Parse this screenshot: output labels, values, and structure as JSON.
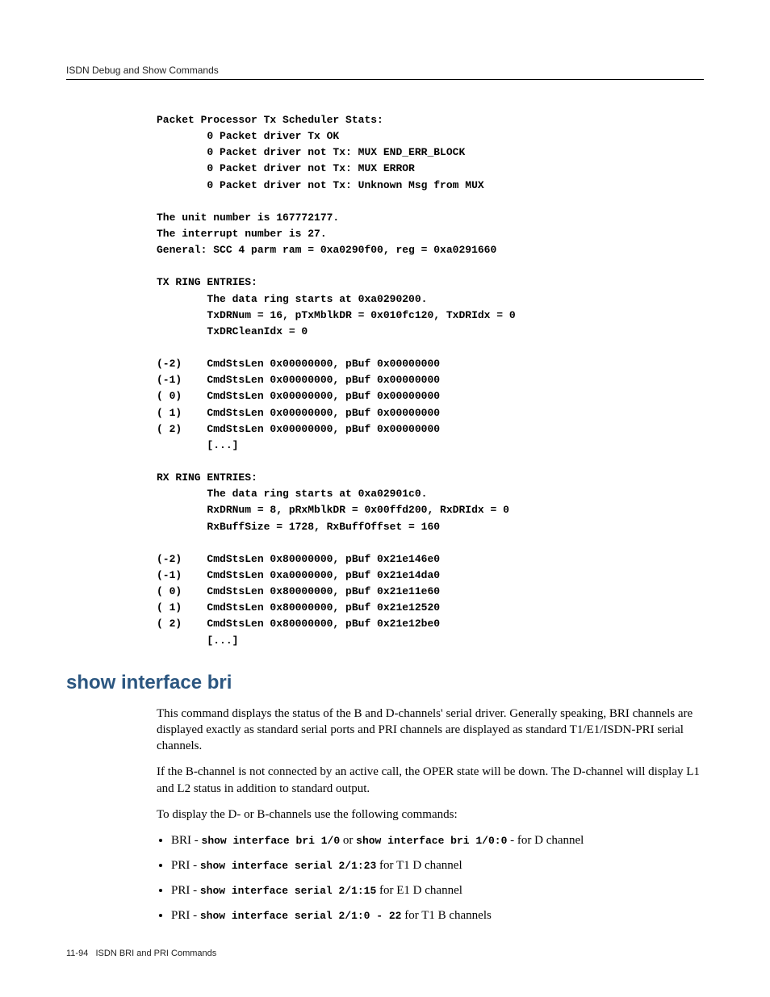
{
  "header": {
    "running_head": "ISDN Debug and Show Commands"
  },
  "code": {
    "block": "Packet Processor Tx Scheduler Stats:\n        0 Packet driver Tx OK\n        0 Packet driver not Tx: MUX END_ERR_BLOCK\n        0 Packet driver not Tx: MUX ERROR\n        0 Packet driver not Tx: Unknown Msg from MUX\n\nThe unit number is 167772177.\nThe interrupt number is 27.\nGeneral: SCC 4 parm ram = 0xa0290f00, reg = 0xa0291660\n\nTX RING ENTRIES:\n        The data ring starts at 0xa0290200.\n        TxDRNum = 16, pTxMblkDR = 0x010fc120, TxDRIdx = 0\n        TxDRCleanIdx = 0\n\n(-2)    CmdStsLen 0x00000000, pBuf 0x00000000\n(-1)    CmdStsLen 0x00000000, pBuf 0x00000000\n( 0)    CmdStsLen 0x00000000, pBuf 0x00000000\n( 1)    CmdStsLen 0x00000000, pBuf 0x00000000\n( 2)    CmdStsLen 0x00000000, pBuf 0x00000000\n        [...]\n\nRX RING ENTRIES:\n        The data ring starts at 0xa02901c0.\n        RxDRNum = 8, pRxMblkDR = 0x00ffd200, RxDRIdx = 0\n        RxBuffSize = 1728, RxBuffOffset = 160\n\n(-2)    CmdStsLen 0x80000000, pBuf 0x21e146e0\n(-1)    CmdStsLen 0xa0000000, pBuf 0x21e14da0\n( 0)    CmdStsLen 0x80000000, pBuf 0x21e11e60\n( 1)    CmdStsLen 0x80000000, pBuf 0x21e12520\n( 2)    CmdStsLen 0x80000000, pBuf 0x21e12be0\n        [...]"
  },
  "section": {
    "title": "show interface bri",
    "p1": "This command displays the status of the B and D-channels' serial driver. Generally speaking, BRI channels are displayed exactly as standard serial ports and PRI channels are displayed as standard T1/E1/ISDN-PRI serial channels.",
    "p2": "If the B-channel is not connected by an active call, the OPER state will be down. The D-channel will display L1 and L2 status in addition to standard output.",
    "p3": "To display the D- or B-channels use the following commands:",
    "bullets": [
      {
        "label": "BRI",
        "sep": " - ",
        "cmd1": "show interface bri 1/0",
        "mid": " or ",
        "cmd2": "show interface bri 1/0:0",
        "tail": " - for D channel"
      },
      {
        "label": "PRI",
        "sep": " - ",
        "cmd1": "show interface serial 2/1:23",
        "mid": "",
        "cmd2": "",
        "tail": " for T1 D channel"
      },
      {
        "label": "PRI",
        "sep": " - ",
        "cmd1": "show interface serial 2/1:15",
        "mid": "",
        "cmd2": "",
        "tail": " for E1 D channel"
      },
      {
        "label": "PRI",
        "sep": " - ",
        "cmd1": "show interface serial 2/1:0 - 22",
        "mid": "",
        "cmd2": "",
        "tail": " for T1 B channels"
      }
    ]
  },
  "footer": {
    "page": "11-94",
    "title": "ISDN BRI and PRI Commands"
  }
}
